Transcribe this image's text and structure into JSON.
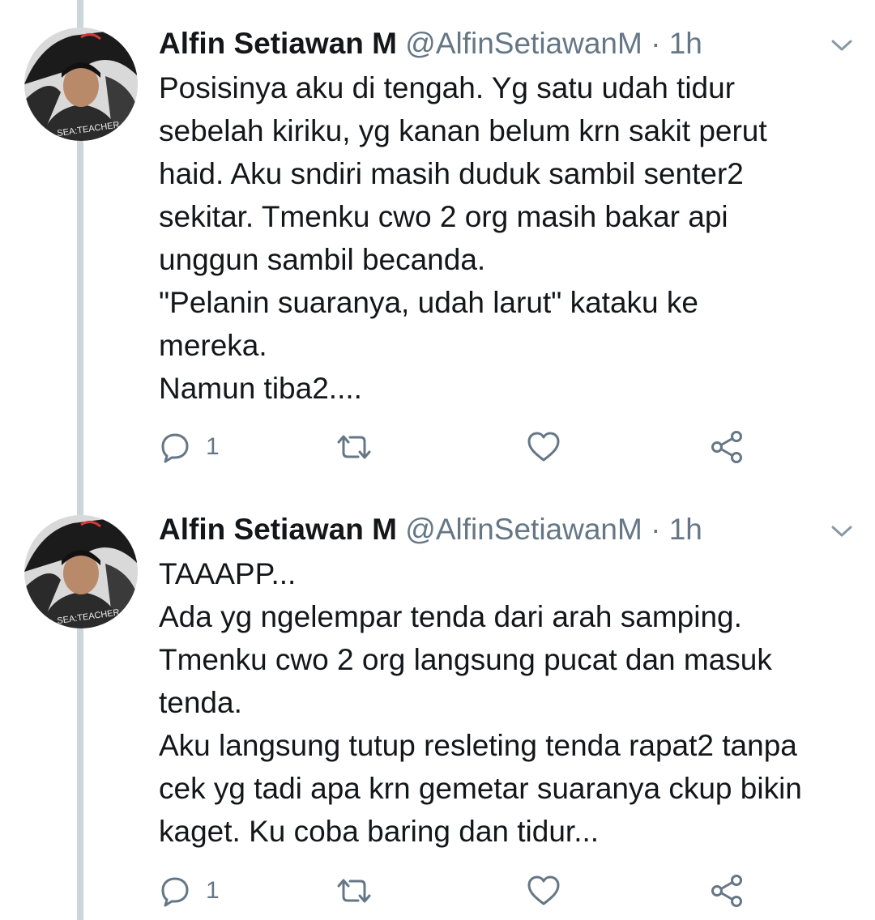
{
  "colors": {
    "thread_line": "#ccd6dd",
    "text_primary": "#14171a",
    "text_secondary": "#657786",
    "icon": "#657786"
  },
  "icons": {
    "reply": "reply-icon",
    "retweet": "retweet-icon",
    "like": "heart-icon",
    "share": "share-icon",
    "menu": "chevron-down-icon"
  },
  "tweets": [
    {
      "name": "Alfin Setiawan M",
      "handle": "@AlfinSetiawanM",
      "separator": "·",
      "time": "1h",
      "avatar_text": "SEA:TEACHER",
      "lines": [
        "Posisinya aku di tengah. Yg satu udah tidur",
        "sebelah kiriku, yg kanan belum krn sakit perut",
        "haid. Aku sndiri masih duduk sambil senter2",
        "sekitar. Tmenku cwo 2 org masih bakar api",
        "unggun sambil becanda.",
        "\"Pelanin suaranya, udah larut\" kataku ke",
        "mereka.",
        "Namun tiba2...."
      ],
      "reply_count": "1"
    },
    {
      "name": "Alfin Setiawan M",
      "handle": "@AlfinSetiawanM",
      "separator": "·",
      "time": "1h",
      "avatar_text": "SEA:TEACHER",
      "lines": [
        "TAAAPP...",
        "Ada yg ngelempar tenda dari arah samping.",
        "Tmenku cwo 2 org langsung pucat dan masuk",
        "tenda.",
        "Aku langsung tutup resleting tenda rapat2 tanpa",
        "cek yg tadi apa krn gemetar suaranya ckup bikin",
        "kaget. Ku coba baring dan tidur..."
      ],
      "reply_count": "1"
    }
  ]
}
